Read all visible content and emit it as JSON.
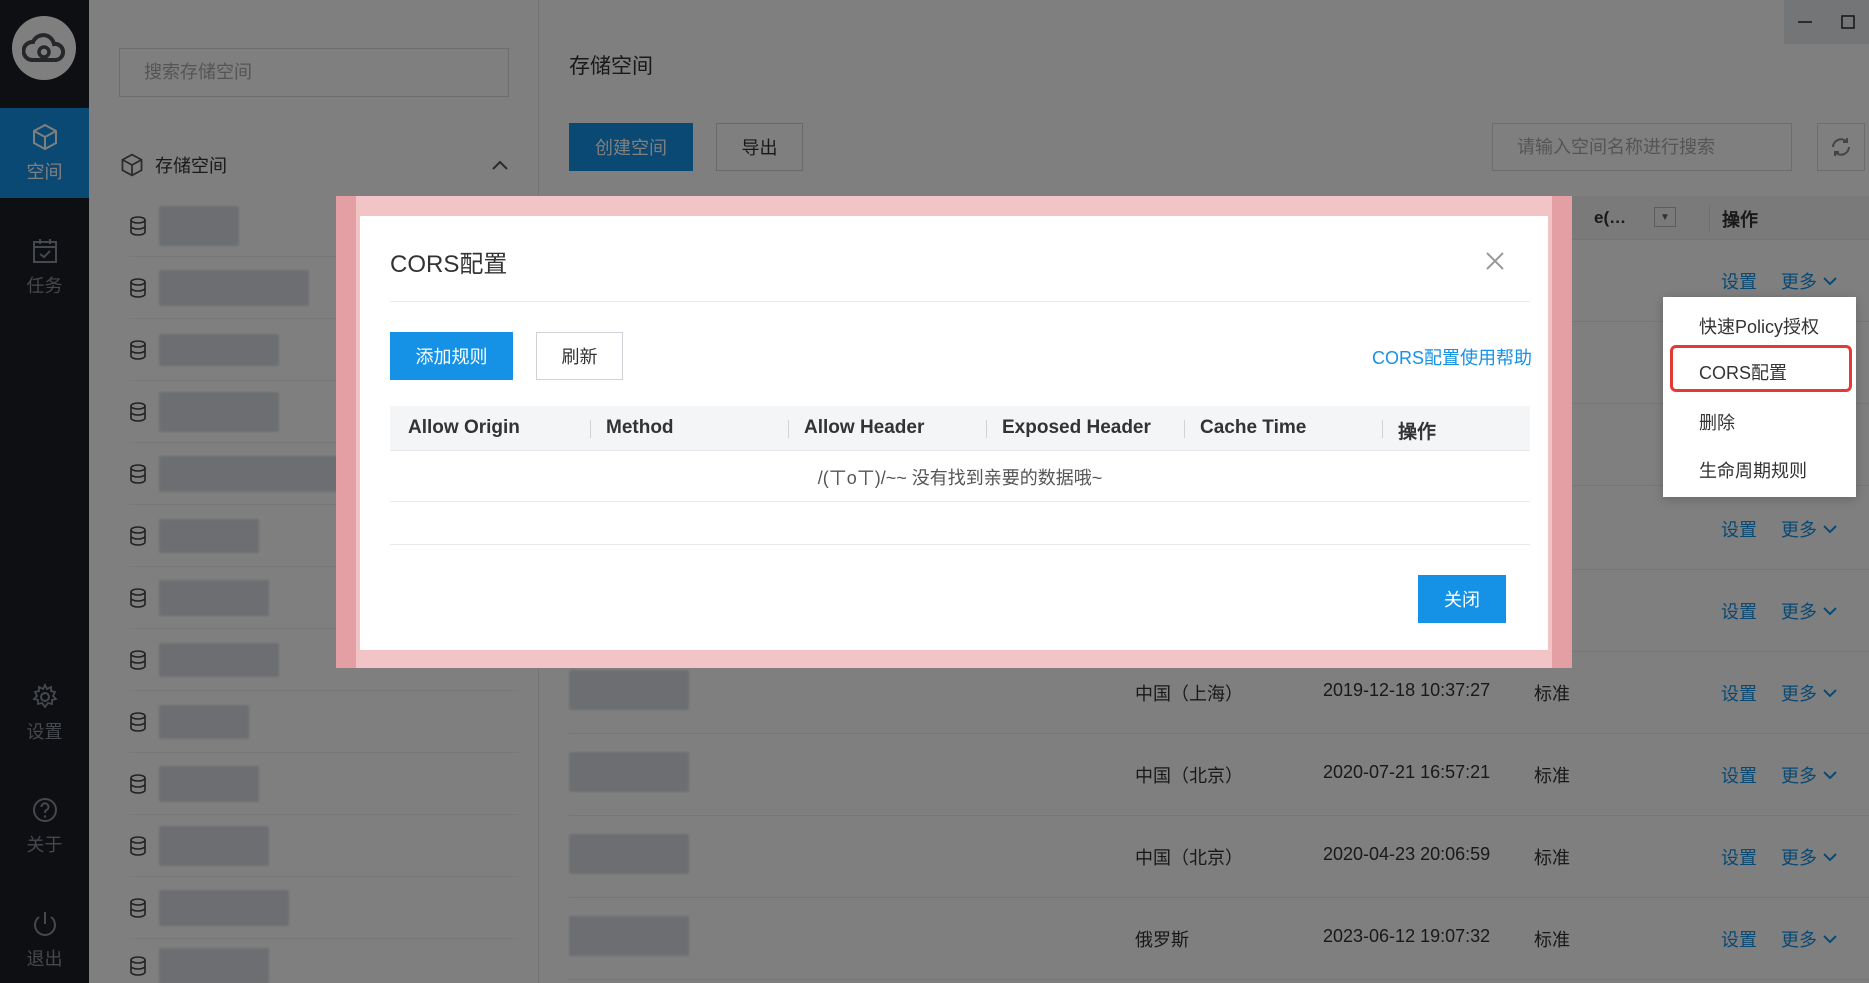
{
  "rail": {
    "items": [
      {
        "label": "空间",
        "icon": "cube-icon"
      },
      {
        "label": "任务",
        "icon": "calendar-check-icon"
      },
      {
        "label": "设置",
        "icon": "gear-icon"
      },
      {
        "label": "关于",
        "icon": "help-icon"
      },
      {
        "label": "退出",
        "icon": "power-icon"
      }
    ]
  },
  "sidebar": {
    "search_placeholder": "搜索存储空间",
    "section_title": "存储空间"
  },
  "main": {
    "title": "存储空间",
    "create_label": "创建空间",
    "export_label": "导出",
    "search_placeholder": "请输入空间名称进行搜索",
    "header": {
      "truncated": "e(…",
      "operation": "操作"
    },
    "action_set": "设置",
    "action_more": "更多",
    "rows": [
      {
        "region": "",
        "time": "",
        "type": ""
      },
      {
        "region": "",
        "time": "",
        "type": ""
      },
      {
        "region": "",
        "time": "",
        "type": ""
      },
      {
        "region": "",
        "time": "",
        "type": ""
      },
      {
        "region": "中国（上海）",
        "time": "2019-12-18 10:37:27",
        "type": "标准"
      },
      {
        "region": "中国（北京）",
        "time": "2020-07-21 16:57:21",
        "type": "标准"
      },
      {
        "region": "中国（北京）",
        "time": "2020-04-23 20:06:59",
        "type": "标准"
      },
      {
        "region": "俄罗斯",
        "time": "2023-06-12 19:07:32",
        "type": "标准"
      }
    ]
  },
  "dropdown": {
    "items": [
      "快速Policy授权",
      "CORS配置",
      "删除",
      "生命周期规则"
    ],
    "highlight_color": "#e53935"
  },
  "modal": {
    "title": "CORS配置",
    "add_rule_label": "添加规则",
    "refresh_label": "刷新",
    "help_link": "CORS配置使用帮助",
    "columns": [
      "Allow Origin",
      "Method",
      "Allow Header",
      "Exposed Header",
      "Cache Time",
      "操作"
    ],
    "empty_text": "/(ㄒoㄒ)/~~ 没有找到亲要的数据哦~",
    "close_label": "关闭"
  },
  "colors": {
    "accent": "#1592e6",
    "rail": "#1b1e24"
  }
}
